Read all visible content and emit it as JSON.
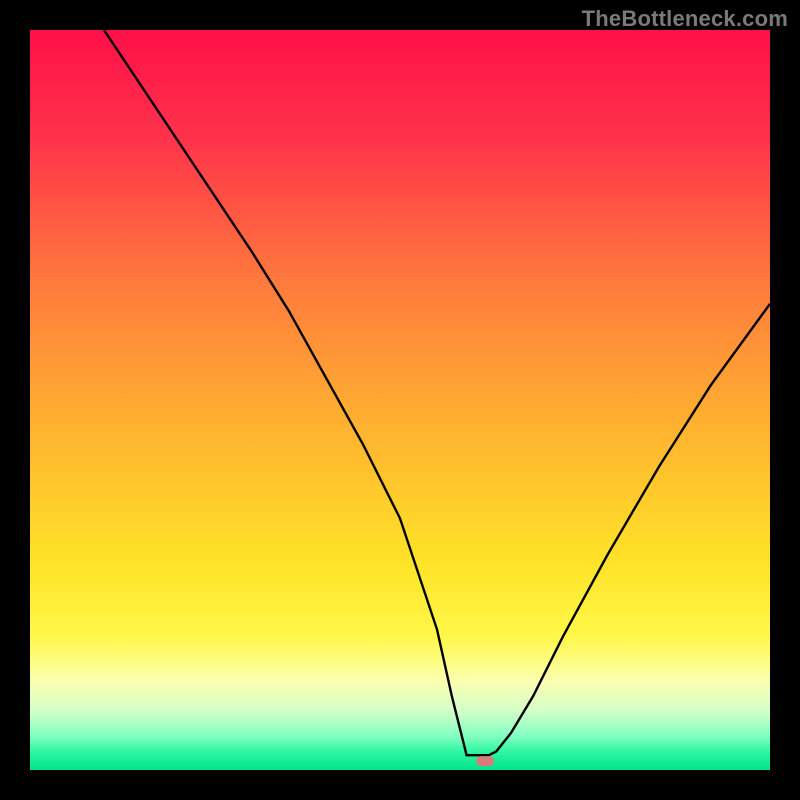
{
  "watermark": "TheBottleneck.com",
  "chart_data": {
    "type": "line",
    "title": "",
    "xlabel": "",
    "ylabel": "",
    "xlim": [
      0,
      100
    ],
    "ylim": [
      0,
      100
    ],
    "grid": false,
    "legend": false,
    "green_band": {
      "y_from": 0,
      "y_to": 3.5
    },
    "highlight_marker": {
      "x": 61.5,
      "y": 1.2
    },
    "series": [
      {
        "name": "bottleneck-curve",
        "x": [
          10,
          20,
          30,
          35,
          40,
          45,
          50,
          55,
          57,
          59,
          62,
          63,
          65,
          68,
          72,
          78,
          85,
          92,
          100
        ],
        "y": [
          100,
          85,
          70,
          62,
          53,
          44,
          34,
          19,
          10,
          2,
          2,
          2.5,
          5,
          10,
          18,
          29,
          41,
          52,
          63
        ]
      }
    ],
    "background_gradient": {
      "stops": [
        {
          "offset": 0.0,
          "color": "#ff1049"
        },
        {
          "offset": 0.15,
          "color": "#ff344a"
        },
        {
          "offset": 0.35,
          "color": "#ff7d3c"
        },
        {
          "offset": 0.55,
          "color": "#ffb62f"
        },
        {
          "offset": 0.72,
          "color": "#ffe327"
        },
        {
          "offset": 0.82,
          "color": "#fff84a"
        },
        {
          "offset": 0.88,
          "color": "#fbffb0"
        },
        {
          "offset": 0.92,
          "color": "#d4ffc9"
        },
        {
          "offset": 0.955,
          "color": "#7fffc0"
        },
        {
          "offset": 0.975,
          "color": "#2ef6a1"
        },
        {
          "offset": 1.0,
          "color": "#00e58b"
        }
      ]
    },
    "colors": {
      "curve": "#000000",
      "marker": "#d97b7b"
    }
  }
}
